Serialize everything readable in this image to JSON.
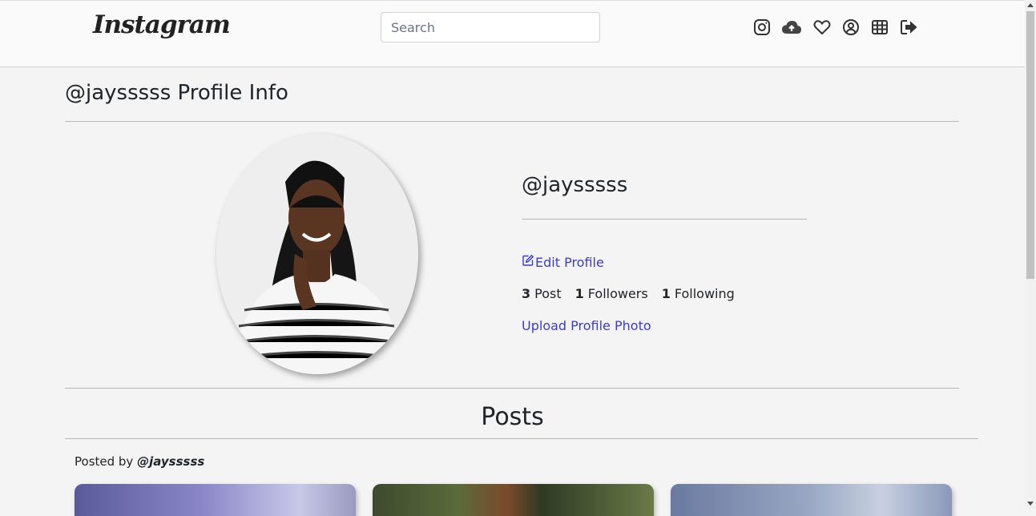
{
  "header": {
    "logo_text": "Instagram",
    "search_placeholder": "Search",
    "icons": [
      "instagram-icon",
      "cloud-upload-icon",
      "heart-icon",
      "user-circle-icon",
      "grid-icon",
      "logout-icon"
    ]
  },
  "profile_info": {
    "title": "@jaysssss Profile Info",
    "username": "@jaysssss",
    "edit_label": "Edit Profile",
    "stats": {
      "posts_count": "3",
      "posts_label": "Post",
      "followers_count": "1",
      "followers_label": "Followers",
      "following_count": "1",
      "following_label": "Following"
    },
    "upload_label": "Upload Profile Photo"
  },
  "posts": {
    "title": "Posts",
    "posted_by_label": "Posted by",
    "posted_by_user": "@jaysssss"
  },
  "colors": {
    "link": "#3b3bd6",
    "background": "#f4f4f4",
    "topbar": "#fafafa"
  }
}
